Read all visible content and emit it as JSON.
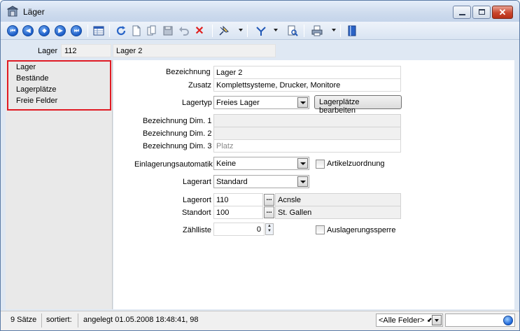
{
  "window": {
    "title": "Läger",
    "min_icon": "minimize-icon",
    "max_icon": "maximize-icon",
    "close_glyph": "✕"
  },
  "toolbar": {
    "icons": [
      "first-record-icon",
      "previous-record-icon",
      "skip-icon",
      "next-record-icon",
      "last-record-icon",
      "table-view-icon",
      "refresh-icon",
      "new-record-icon",
      "copy-record-icon",
      "save-icon",
      "undo-icon",
      "delete-icon",
      "pin-icon",
      "filter-icon",
      "document-search-icon",
      "print-icon",
      "book-icon"
    ],
    "nav_first": "⏮",
    "nav_prev": "◀",
    "nav_skip": "◆",
    "nav_next": "▶",
    "nav_last": "⏭",
    "delete_glyph": "✕"
  },
  "header": {
    "label": "Lager",
    "number": "112",
    "name": "Lager 2"
  },
  "sidebar": {
    "items": [
      {
        "label": "Lager"
      },
      {
        "label": "Bestände"
      },
      {
        "label": "Lagerplätze"
      },
      {
        "label": "Freie Felder"
      }
    ]
  },
  "form": {
    "bezeichnung_label": "Bezeichnung",
    "bezeichnung_value": "Lager 2",
    "zusatz_label": "Zusatz",
    "zusatz_value": "Komplettsysteme, Drucker, Monitore",
    "lagertyp_label": "Lagertyp",
    "lagertyp_value": "Freies Lager",
    "lagerplaetze_button": "Lagerplätze bearbeiten",
    "dim1_label": "Bezeichnung Dim. 1",
    "dim1_value": "",
    "dim2_label": "Bezeichnung Dim. 2",
    "dim2_value": "",
    "dim3_label": "Bezeichnung Dim. 3",
    "dim3_placeholder": "Platz",
    "einlagerung_label": "Einlagerungsautomatik",
    "einlagerung_value": "Keine",
    "artikelzuordnung_label": "Artikelzuordnung",
    "lagerart_label": "Lagerart",
    "lagerart_value": "Standard",
    "lagerort_label": "Lagerort",
    "lagerort_value": "110",
    "lagerort_desc": "Acnsle",
    "standort_label": "Standort",
    "standort_value": "100",
    "standort_desc": "St. Gallen",
    "zaehlliste_label": "Zählliste",
    "zaehlliste_value": "0",
    "auslagerungssperre_label": "Auslagerungssperre",
    "lookup_glyph": "..."
  },
  "statusbar": {
    "count": "9 Sätze",
    "sorted": "sortiert:",
    "created": "angelegt 01.05.2008 18:48:41, 98",
    "field_filter": "<Alle Felder>",
    "filter_arrow": "⬋"
  }
}
